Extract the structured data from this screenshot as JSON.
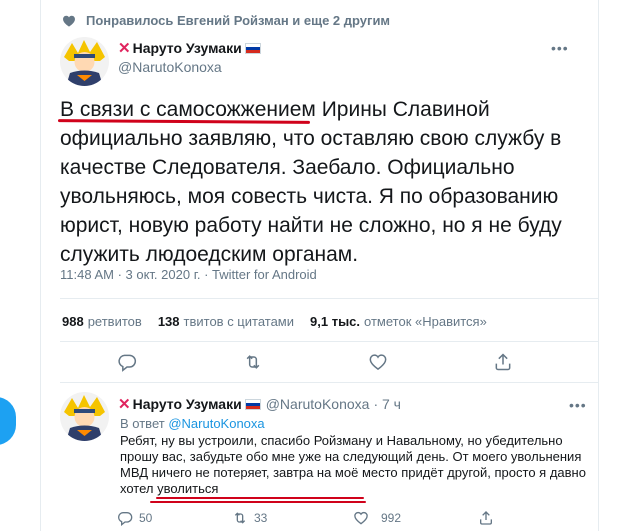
{
  "liked_bar": {
    "text": "Понравилось Евгений Ройзман и еще 2 другим"
  },
  "tweet": {
    "author_name": "Наруто Узумаки",
    "author_handle": "@NarutoKonoxa",
    "text_underlined": "В связи с самосожжением",
    "text_rest": " Ирины Славиной официально заявляю, что оставляю свою службу в качестве Следователя. Заебало. Официально увольняюсь, моя совесть чиста. Я по образованию юрист, новую работу найти не сложно, но я не буду служить людоедским органам.",
    "meta": "11:48 AM · 3 окт. 2020 г. · Twitter for Android",
    "stats": {
      "retweets_count": "988",
      "retweets_label": "ретвитов",
      "quotes_count": "138",
      "quotes_label": "твитов с цитатами",
      "likes_count": "9,1 тыс.",
      "likes_label": "отметок «Нравится»"
    }
  },
  "reply": {
    "author_name": "Наруто Узумаки",
    "author_handle": "@NarutoKonoxa",
    "time": "· 7 ч",
    "reply_to_label": "В ответ",
    "reply_to_handle": "@NarutoKonoxa",
    "text_main": "Ребят, ну вы устроили, спасибо Ройзману и Навальному, но убедительно прошу вас, забудьте обо мне уже на следующий день. От моего увольнения МВД ничего не потеряет, завтра на моё место придёт другой, ",
    "text_underlined": "просто я давно хотел уволиться",
    "counts": {
      "replies": "50",
      "retweets": "33",
      "likes": "992"
    }
  },
  "colors": {
    "accent": "#1da1f2",
    "text_secondary": "#657786",
    "underline": "#d0021b",
    "divider": "#e6ecf0"
  },
  "icons": [
    "heart-icon",
    "more-icon",
    "reply-icon",
    "retweet-icon",
    "share-icon",
    "russia-flag-icon",
    "red-x-icon"
  ]
}
